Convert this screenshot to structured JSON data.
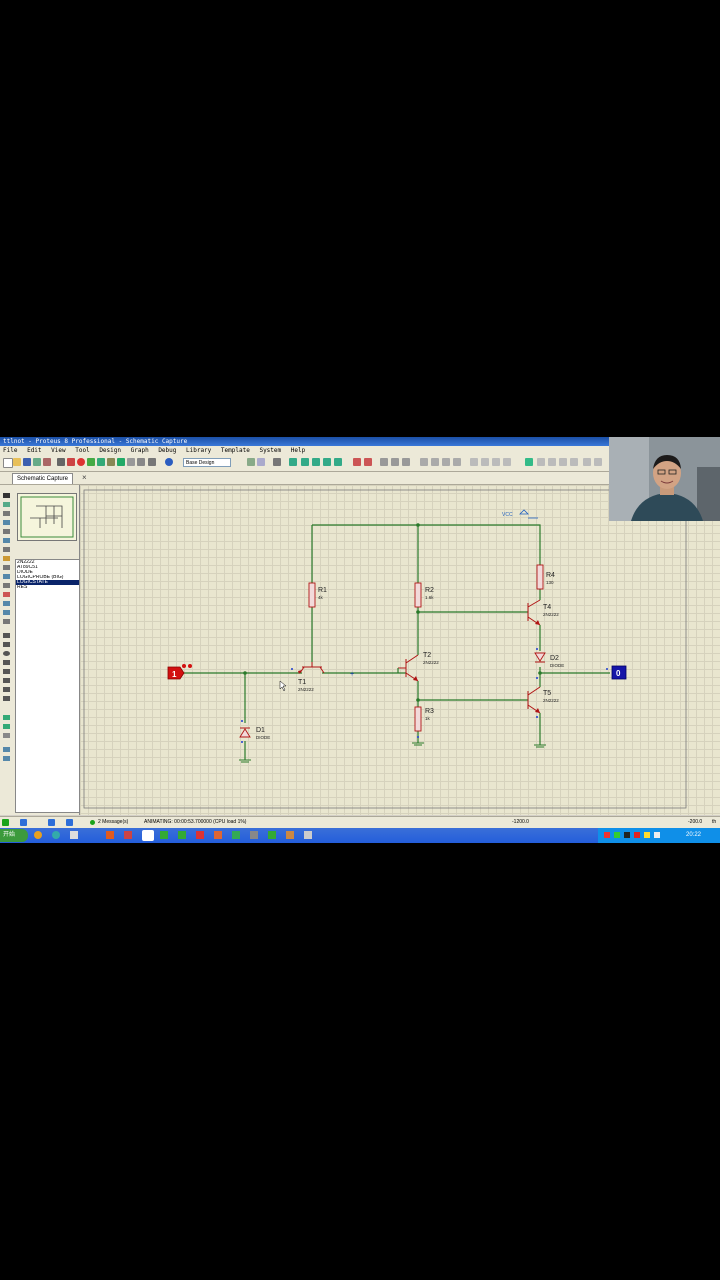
{
  "window": {
    "title": "ttlnot - Proteus 8 Professional - Schematic Capture"
  },
  "menu": [
    "File",
    "Edit",
    "View",
    "Tool",
    "Design",
    "Graph",
    "Debug",
    "Library",
    "Template",
    "System",
    "Help"
  ],
  "toolbar": {
    "design_select": "Base Design"
  },
  "tab": {
    "label": "Schematic Capture",
    "close": "×"
  },
  "panel": {
    "mode_buttons": [
      "P",
      "L"
    ],
    "devices": [
      "2N2222",
      "AT89C51",
      "DIODE",
      "LOGICPROBE (BIG)",
      "LOGICSTATE",
      "RES"
    ],
    "selected_index": 4
  },
  "schematic": {
    "input_state": "1",
    "output_probe": "0",
    "vcc_label": "VCC",
    "components": {
      "R1": {
        "name": "R1",
        "value": "4k"
      },
      "R2": {
        "name": "R2",
        "value": "1.6k"
      },
      "R3": {
        "name": "R3",
        "value": "1k"
      },
      "R4": {
        "name": "R4",
        "value": "130"
      },
      "T1": {
        "name": "T1",
        "value": "2N2222"
      },
      "T2": {
        "name": "T2",
        "value": "2N2222"
      },
      "T4": {
        "name": "T4",
        "value": "2N2222"
      },
      "T5": {
        "name": "T5",
        "value": "2N2222"
      },
      "D1": {
        "name": "D1",
        "value": "DIODE"
      },
      "D2": {
        "name": "D2",
        "value": "DIODE"
      }
    }
  },
  "status": {
    "messages": "2 Message(s)",
    "animating": "ANIMATING: 00:00:53.700000 (CPU load 1%)",
    "coord_x": "-1200.0",
    "coord_y": "-200.0",
    "unit": "th"
  },
  "taskbar": {
    "start": "开始",
    "clock": "20:22"
  },
  "colors": {
    "wire": "#2a7a2a",
    "component": "#b01414",
    "logicstate_high": "#d21010",
    "probe_low": "#1515a8",
    "titlebar": "#1b4fa6"
  }
}
